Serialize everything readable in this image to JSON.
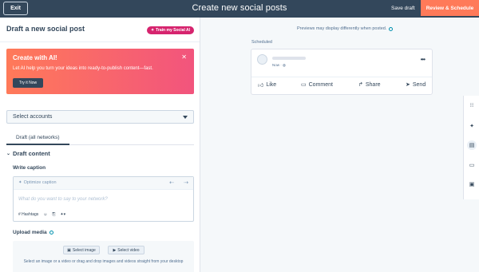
{
  "topbar": {
    "exit_label": "Exit",
    "title": "Create new social posts",
    "save_draft_label": "Save draft",
    "review_label": "Review & Schedule"
  },
  "left": {
    "title": "Draft a new social post",
    "train_ai_label": "Train my Social AI",
    "ai_card": {
      "title": "Create with AI!",
      "body": "Let AI help you turn your ideas into ready-to-publish content—fast.",
      "cta": "Try it Now",
      "close_icon": "close-icon"
    },
    "select_accounts": {
      "value": "Select accounts"
    },
    "tabs": [
      {
        "label": "Draft (all networks)"
      }
    ],
    "draft_content": {
      "label": "Draft content"
    },
    "caption": {
      "label": "Write caption",
      "optimize_label": "Optimize caption",
      "placeholder": "What do you want to say to your network?",
      "hashtags_label": "# Hashtags"
    },
    "upload": {
      "label": "Upload media",
      "select_image": "Select image",
      "select_video": "Select video",
      "hint": "Select an image or a video or drag and drop images and videos straight from your desktop"
    }
  },
  "preview": {
    "note": "Previews may display differently when posted.",
    "scheduled_label": "Scheduled",
    "time": "Now ·",
    "actions": [
      {
        "label": "Like",
        "icon": "thumbs-up-icon"
      },
      {
        "label": "Comment",
        "icon": "comment-icon"
      },
      {
        "label": "Share",
        "icon": "share-icon"
      },
      {
        "label": "Send",
        "icon": "send-icon"
      }
    ]
  },
  "colors": {
    "topbar": "#33475b",
    "accent": "#ff7a59",
    "ai_pink": "#d6246e"
  }
}
